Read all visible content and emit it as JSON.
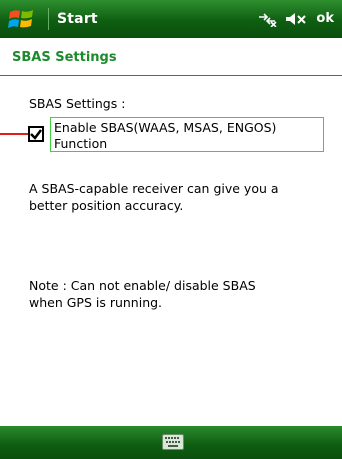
{
  "titlebar": {
    "title": "Start",
    "ok_label": "ok",
    "icons": [
      "windows-start-icon",
      "connectivity-icon",
      "volume-muted-icon"
    ]
  },
  "header": {
    "title": "SBAS Settings"
  },
  "content": {
    "section_label": "SBAS Settings :",
    "checkbox_label_line1": "Enable SBAS(WAAS, MSAS, ENGOS)",
    "checkbox_label_line2": "Function",
    "checkbox_checked": true,
    "description_line1": "A SBAS-capable receiver can give you a",
    "description_line2": "better position accuracy.",
    "note_line1": "Note : Can not enable/ disable SBAS",
    "note_line2": "when GPS is running."
  },
  "softbar": {
    "icons": [
      "keyboard-icon"
    ]
  },
  "colors": {
    "bar_green": "#0f5e12",
    "header_green": "#1d8a2e",
    "highlight_green": "#3fcf3f",
    "pointer_red": "#e21d1d"
  }
}
